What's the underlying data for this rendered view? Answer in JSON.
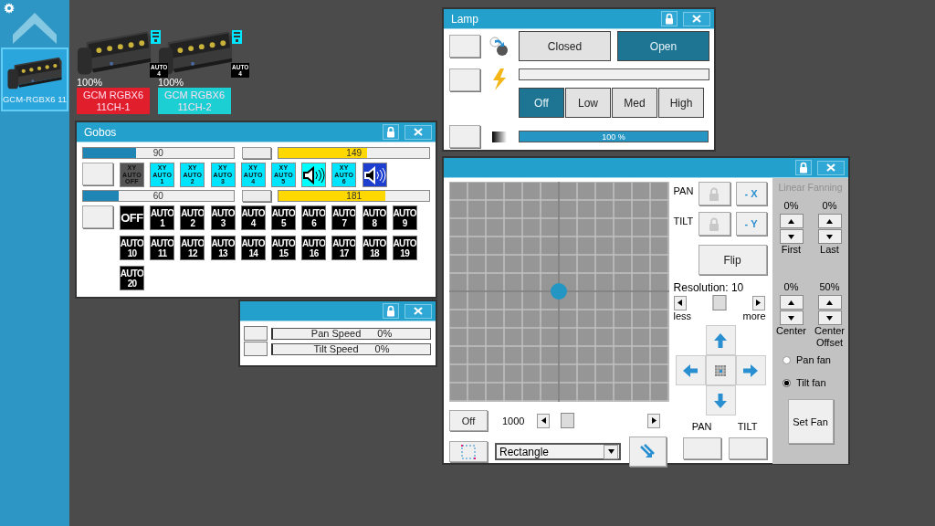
{
  "sidebar": {
    "fixtures": [
      {
        "label": "GCM-RGBX6 11",
        "selected": true
      }
    ]
  },
  "canvas_fixtures": [
    {
      "intensity": "100%",
      "name": "GCM RGBX6",
      "channel": "11CH-1",
      "color": "#e01e2c",
      "badge_lines": [
        "AUTO",
        "4"
      ]
    },
    {
      "intensity": "100%",
      "name": "GCM RGBX6",
      "channel": "11CH-2",
      "color": "#1ccfd2",
      "badge_lines": [
        "AUTO",
        "4"
      ]
    }
  ],
  "gobos_window": {
    "title": "Gobos",
    "wheels": [
      {
        "slider": {
          "value": "90",
          "level": 0.353
        },
        "fine": {
          "value": "149",
          "level": 0.584
        },
        "gobos": [
          {
            "kind": "xy",
            "lines": [
              "XY",
              "AUTO",
              "OFF"
            ],
            "color": "#555555"
          },
          {
            "kind": "xy",
            "lines": [
              "XY",
              "AUTO",
              "1"
            ],
            "color": "#00e5ff"
          },
          {
            "kind": "xy",
            "lines": [
              "XY",
              "AUTO",
              "2"
            ],
            "color": "#00e5ff"
          },
          {
            "kind": "xy",
            "lines": [
              "XY",
              "AUTO",
              "3"
            ],
            "color": "#00e5ff"
          },
          {
            "kind": "xy",
            "lines": [
              "XY",
              "AUTO",
              "4"
            ],
            "color": "#00e5ff"
          },
          {
            "kind": "xy",
            "lines": [
              "XY",
              "AUTO",
              "5"
            ],
            "color": "#00e5ff"
          },
          {
            "kind": "sound",
            "color": "#00ffff"
          },
          {
            "kind": "xy",
            "lines": [
              "XY",
              "AUTO",
              "6"
            ],
            "color": "#00e5ff"
          },
          {
            "kind": "sound",
            "color": "#1e3ed0"
          }
        ]
      },
      {
        "slider": {
          "value": "60",
          "level": 0.235
        },
        "fine": {
          "value": "181",
          "level": 0.71
        },
        "gobos": [
          {
            "kind": "off",
            "lines": [
              "OFF"
            ],
            "color": "#000000"
          },
          {
            "kind": "auto",
            "lines": [
              "AUTO",
              "1"
            ],
            "color": "#000000"
          },
          {
            "kind": "auto",
            "lines": [
              "AUTO",
              "2"
            ],
            "color": "#000000"
          },
          {
            "kind": "auto",
            "lines": [
              "AUTO",
              "3"
            ],
            "color": "#000000"
          },
          {
            "kind": "auto",
            "lines": [
              "AUTO",
              "4"
            ],
            "color": "#000000"
          },
          {
            "kind": "auto",
            "lines": [
              "AUTO",
              "5"
            ],
            "color": "#000000"
          },
          {
            "kind": "auto",
            "lines": [
              "AUTO",
              "6"
            ],
            "color": "#000000"
          },
          {
            "kind": "auto",
            "lines": [
              "AUTO",
              "7"
            ],
            "color": "#000000"
          },
          {
            "kind": "auto",
            "lines": [
              "AUTO",
              "8"
            ],
            "color": "#000000"
          },
          {
            "kind": "auto",
            "lines": [
              "AUTO",
              "9"
            ],
            "color": "#000000"
          },
          {
            "kind": "auto",
            "lines": [
              "AUTO",
              "10"
            ],
            "color": "#000000"
          },
          {
            "kind": "auto",
            "lines": [
              "AUTO",
              "11"
            ],
            "color": "#000000"
          },
          {
            "kind": "auto",
            "lines": [
              "AUTO",
              "12"
            ],
            "color": "#000000"
          },
          {
            "kind": "auto",
            "lines": [
              "AUTO",
              "13"
            ],
            "color": "#000000"
          },
          {
            "kind": "auto",
            "lines": [
              "AUTO",
              "14"
            ],
            "color": "#000000"
          },
          {
            "kind": "auto",
            "lines": [
              "AUTO",
              "15"
            ],
            "color": "#000000"
          },
          {
            "kind": "auto",
            "lines": [
              "AUTO",
              "16"
            ],
            "color": "#000000"
          },
          {
            "kind": "auto",
            "lines": [
              "AUTO",
              "17"
            ],
            "color": "#000000"
          },
          {
            "kind": "auto",
            "lines": [
              "AUTO",
              "18"
            ],
            "color": "#000000"
          },
          {
            "kind": "auto",
            "lines": [
              "AUTO",
              "19"
            ],
            "color": "#000000"
          },
          {
            "kind": "auto",
            "lines": [
              "AUTO",
              "20"
            ],
            "color": "#000000"
          }
        ]
      }
    ]
  },
  "lamp_window": {
    "title": "Lamp",
    "shutter": [
      {
        "label": "Closed",
        "selected": false
      },
      {
        "label": "Open",
        "selected": true
      }
    ],
    "power": {
      "level": 0
    },
    "power_modes": [
      {
        "label": "Off",
        "selected": true
      },
      {
        "label": "Low",
        "selected": false
      },
      {
        "label": "Med",
        "selected": false
      },
      {
        "label": "High",
        "selected": false
      }
    ],
    "dimmer": {
      "level": 1,
      "reading": "100 %"
    }
  },
  "speed_window": {
    "channels": [
      {
        "label": "Pan Speed",
        "reading": "0%",
        "level": 0
      },
      {
        "label": "Tilt Speed",
        "reading": "0%",
        "level": 0
      }
    ]
  },
  "position_window": {
    "axes": [
      {
        "label": "PAN",
        "invert": "- X"
      },
      {
        "label": "TILT",
        "invert": "- Y"
      }
    ],
    "flip": "Flip",
    "resolution": {
      "label": "Resolution: 10",
      "level": 0.5,
      "less": "less",
      "more": "more"
    },
    "off_button": "Off",
    "speed": {
      "value": "1000",
      "level": 0.08
    },
    "pattern": "Rectangle",
    "bottom_labels": [
      "PAN",
      "TILT"
    ],
    "fanning": {
      "title": "Linear Fanning",
      "disabled": true,
      "spinners": [
        {
          "value": "0%",
          "label": "First"
        },
        {
          "value": "0%",
          "label": "Last"
        },
        {
          "value": "0%",
          "label": "Center"
        },
        {
          "value": "50%",
          "label": "Center Offset"
        }
      ],
      "modes": [
        {
          "label": "Pan fan",
          "selected": false
        },
        {
          "label": "Tilt fan",
          "selected": true
        }
      ],
      "button": "Set Fan"
    }
  }
}
